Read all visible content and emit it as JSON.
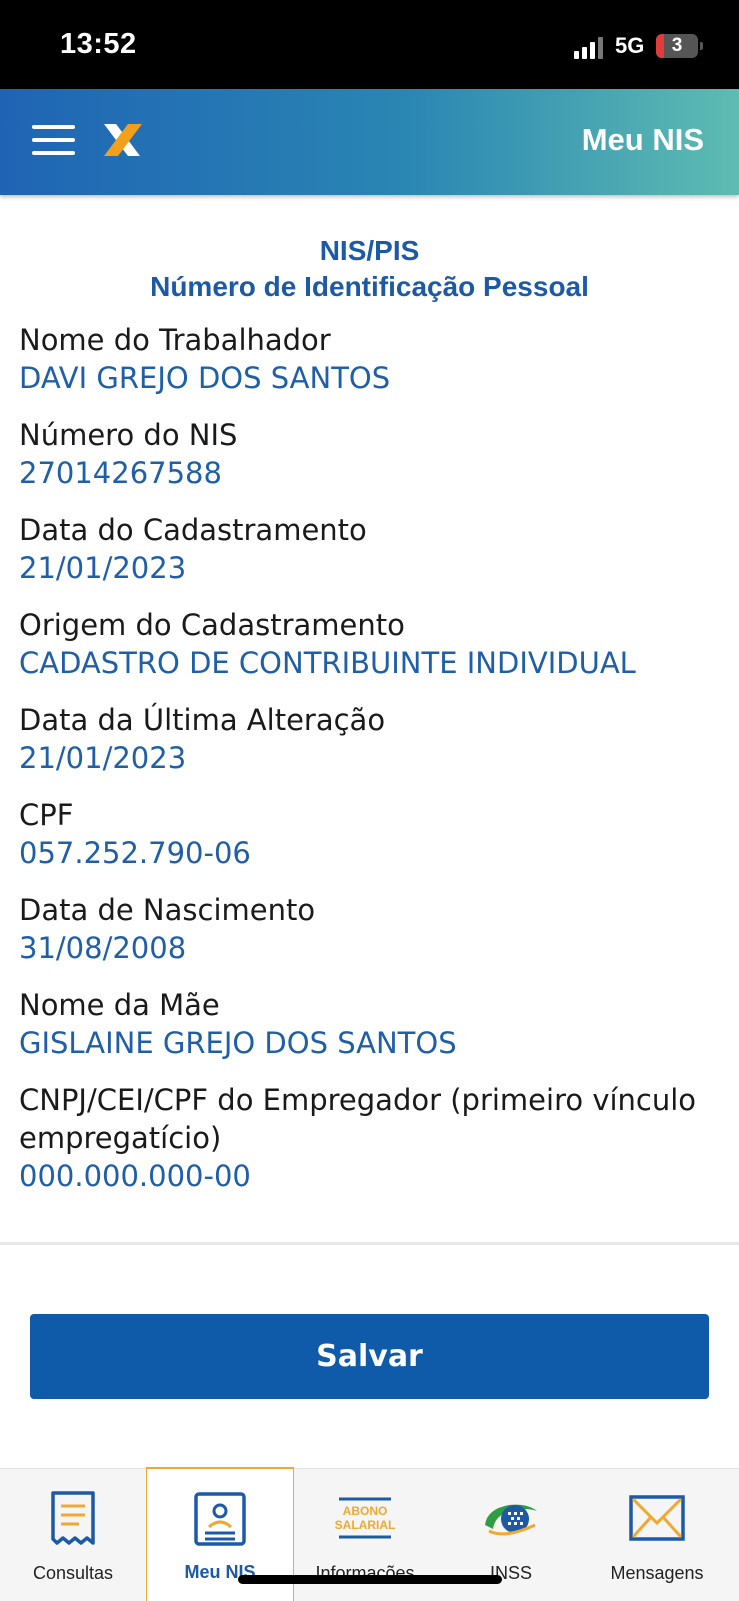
{
  "status_bar": {
    "time": "13:52",
    "network": "5G",
    "battery": "3"
  },
  "header": {
    "title": "Meu NIS"
  },
  "section": {
    "title_line1": "NIS/PIS",
    "title_line2": "Número de Identificação Pessoal"
  },
  "fields": [
    {
      "label": "Nome do Trabalhador",
      "value": "DAVI GREJO DOS SANTOS"
    },
    {
      "label": "Número do NIS",
      "value": "27014267588"
    },
    {
      "label": "Data do Cadastramento",
      "value": "21/01/2023"
    },
    {
      "label": "Origem do Cadastramento",
      "value": "CADASTRO DE CONTRIBUINTE INDIVIDUAL"
    },
    {
      "label": "Data da Última Alteração",
      "value": "21/01/2023"
    },
    {
      "label": "CPF",
      "value": "057.252.790-06"
    },
    {
      "label": "Data de Nascimento",
      "value": "31/08/2008"
    },
    {
      "label": "Nome da Mãe",
      "value": "GISLAINE GREJO DOS SANTOS"
    },
    {
      "label": "CNPJ/CEI/CPF do Empregador (primeiro vínculo empregatício)",
      "value": "000.000.000-00"
    }
  ],
  "save_button": {
    "label": "Salvar"
  },
  "bottom_nav": {
    "items": [
      {
        "label": "Consultas",
        "icon": "document-list-icon"
      },
      {
        "label": "Meu NIS",
        "icon": "id-card-icon",
        "active": true
      },
      {
        "label": "Informações",
        "icon": "abono-salarial-icon",
        "icon_text_1": "ABONO",
        "icon_text_2": "SALARIAL"
      },
      {
        "label": "INSS",
        "icon": "inss-logo-icon"
      },
      {
        "label": "Mensagens",
        "icon": "envelope-icon"
      }
    ]
  },
  "colors": {
    "primary_blue": "#1c5aa5",
    "button_blue": "#0f5aa9",
    "accent_orange": "#f0a830",
    "value_blue": "#1f5fa8"
  }
}
